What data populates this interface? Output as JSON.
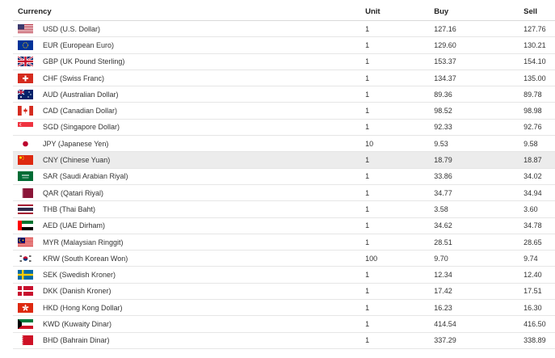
{
  "table": {
    "headers": {
      "currency": "Currency",
      "unit": "Unit",
      "buy": "Buy",
      "sell": "Sell"
    },
    "rows": [
      {
        "flag": "flag-usa-icon",
        "currency": "USD (U.S. Dollar)",
        "unit": "1",
        "buy": "127.16",
        "sell": "127.76"
      },
      {
        "flag": "flag-eu-icon",
        "currency": "EUR (European Euro)",
        "unit": "1",
        "buy": "129.60",
        "sell": "130.21"
      },
      {
        "flag": "flag-uk-icon",
        "currency": "GBP (UK Pound Sterling)",
        "unit": "1",
        "buy": "153.37",
        "sell": "154.10"
      },
      {
        "flag": "flag-switzerland-icon",
        "currency": "CHF (Swiss Franc)",
        "unit": "1",
        "buy": "134.37",
        "sell": "135.00"
      },
      {
        "flag": "flag-australia-icon",
        "currency": "AUD (Australian Dollar)",
        "unit": "1",
        "buy": "89.36",
        "sell": "89.78"
      },
      {
        "flag": "flag-canada-icon",
        "currency": "CAD (Canadian Dollar)",
        "unit": "1",
        "buy": "98.52",
        "sell": "98.98"
      },
      {
        "flag": "flag-singapore-icon",
        "currency": "SGD (Singapore Dollar)",
        "unit": "1",
        "buy": "92.33",
        "sell": "92.76"
      },
      {
        "flag": "flag-japan-icon",
        "currency": "JPY (Japanese Yen)",
        "unit": "10",
        "buy": "9.53",
        "sell": "9.58"
      },
      {
        "flag": "flag-china-icon",
        "currency": "CNY (Chinese Yuan)",
        "unit": "1",
        "buy": "18.79",
        "sell": "18.87",
        "highlighted": true
      },
      {
        "flag": "flag-saudi-arabia-icon",
        "currency": "SAR (Saudi Arabian Riyal)",
        "unit": "1",
        "buy": "33.86",
        "sell": "34.02"
      },
      {
        "flag": "flag-qatar-icon",
        "currency": "QAR (Qatari Riyal)",
        "unit": "1",
        "buy": "34.77",
        "sell": "34.94"
      },
      {
        "flag": "flag-thailand-icon",
        "currency": "THB (Thai Baht)",
        "unit": "1",
        "buy": "3.58",
        "sell": "3.60"
      },
      {
        "flag": "flag-uae-icon",
        "currency": "AED (UAE Dirham)",
        "unit": "1",
        "buy": "34.62",
        "sell": "34.78"
      },
      {
        "flag": "flag-malaysia-icon",
        "currency": "MYR (Malaysian Ringgit)",
        "unit": "1",
        "buy": "28.51",
        "sell": "28.65"
      },
      {
        "flag": "flag-south-korea-icon",
        "currency": "KRW (South Korean Won)",
        "unit": "100",
        "buy": "9.70",
        "sell": "9.74"
      },
      {
        "flag": "flag-sweden-icon",
        "currency": "SEK (Swedish Kroner)",
        "unit": "1",
        "buy": "12.34",
        "sell": "12.40"
      },
      {
        "flag": "flag-denmark-icon",
        "currency": "DKK (Danish Kroner)",
        "unit": "1",
        "buy": "17.42",
        "sell": "17.51"
      },
      {
        "flag": "flag-hong-kong-icon",
        "currency": "HKD (Hong Kong Dollar)",
        "unit": "1",
        "buy": "16.23",
        "sell": "16.30"
      },
      {
        "flag": "flag-kuwait-icon",
        "currency": "KWD (Kuwaity Dinar)",
        "unit": "1",
        "buy": "414.54",
        "sell": "416.50"
      },
      {
        "flag": "flag-bahrain-icon",
        "currency": "BHD (Bahrain Dinar)",
        "unit": "1",
        "buy": "337.29",
        "sell": "338.89"
      }
    ]
  },
  "colors": {
    "highlight_row": "#ececec",
    "border": "#e6e6e6"
  }
}
